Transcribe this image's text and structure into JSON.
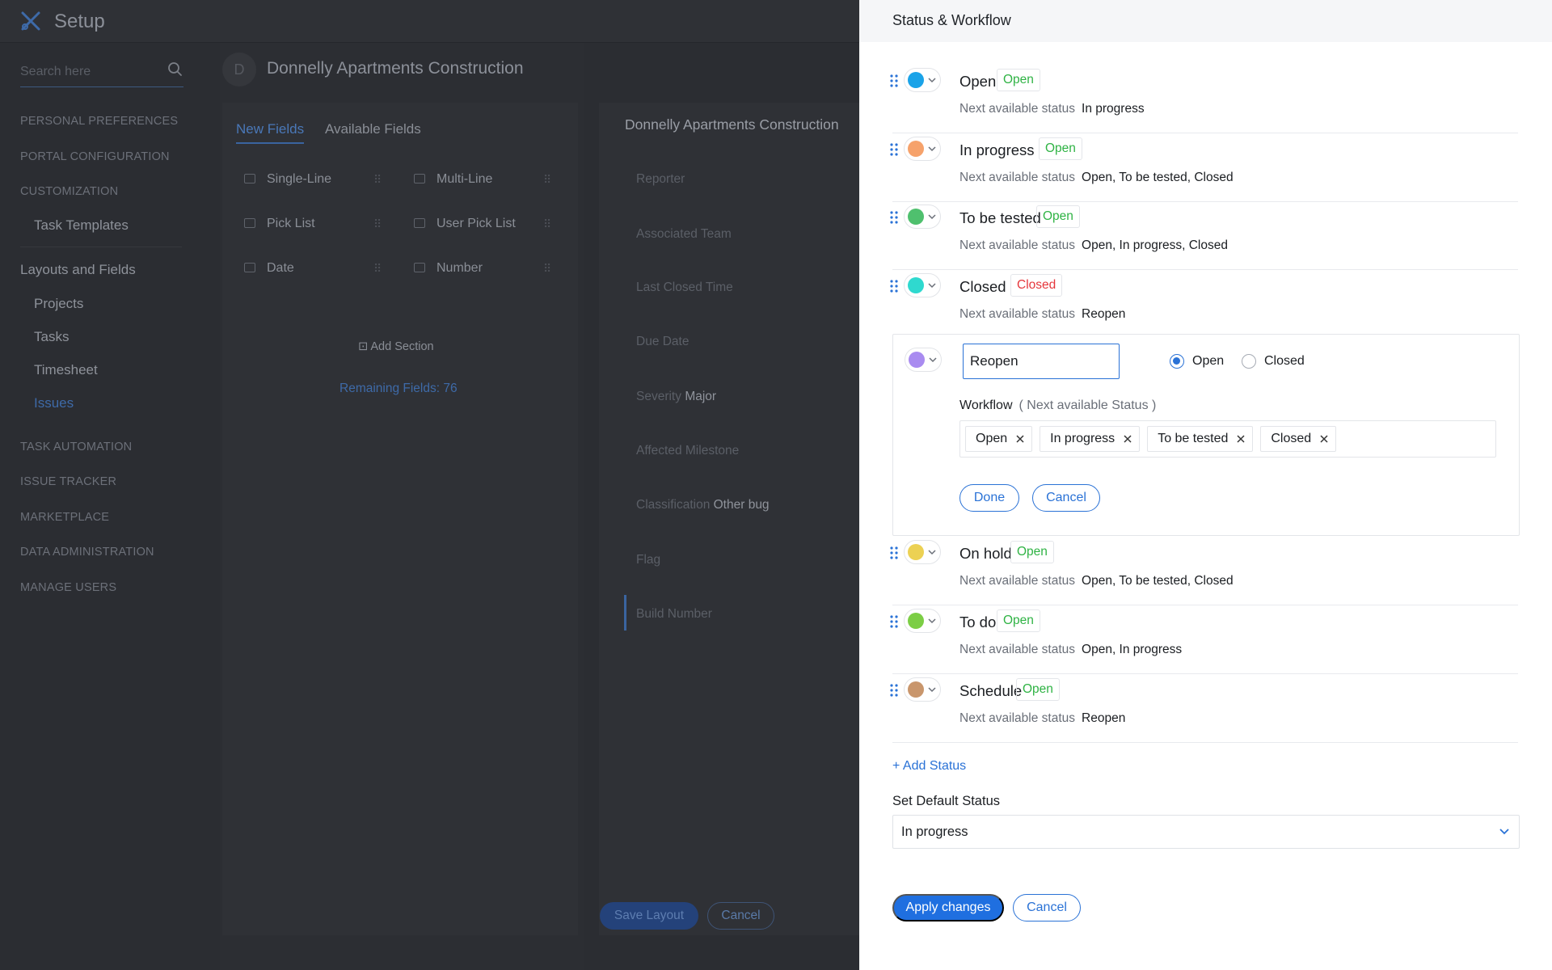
{
  "app": {
    "title": "Setup"
  },
  "search": {
    "placeholder": "Search here"
  },
  "sidebar": {
    "sections": [
      "PERSONAL PREFERENCES",
      "PORTAL CONFIGURATION",
      "CUSTOMIZATION",
      "TASK AUTOMATION",
      "ISSUE TRACKER",
      "MARKETPLACE",
      "DATA ADMINISTRATION",
      "MANAGE USERS"
    ],
    "task_templates": "Task Templates",
    "layouts_group": "Layouts and Fields",
    "layout_items": [
      "Projects",
      "Tasks",
      "Timesheet",
      "Issues"
    ]
  },
  "project": {
    "avatar": "D",
    "title": "Donnelly Apartments Construction"
  },
  "fields": {
    "tabs": [
      "New Fields",
      "Available Fields"
    ],
    "items": [
      "Single-Line",
      "Multi-Line",
      "Pick List",
      "User Pick List",
      "Date",
      "Number"
    ],
    "add_section": "Add Section",
    "remaining": "Remaining Fields: 76"
  },
  "preview": {
    "title": "Donnelly Apartments Construction",
    "rows": [
      {
        "label": "Reporter",
        "value": ""
      },
      {
        "label": "Associated Team",
        "value": ""
      },
      {
        "label": "Last Closed Time",
        "value": ""
      },
      {
        "label": "Due Date",
        "value": ""
      },
      {
        "label": "Severity",
        "value": "Major"
      },
      {
        "label": "Affected Milestone",
        "value": ""
      },
      {
        "label": "Classification",
        "value": "Other bug"
      },
      {
        "label": "Flag",
        "value": ""
      },
      {
        "label": "Build Number",
        "value": ""
      }
    ],
    "save_label": "Save Layout",
    "cancel_label": "Cancel"
  },
  "panel": {
    "title": "Status & Workflow",
    "next_label": "Next available status",
    "statuses": [
      {
        "name": "Open",
        "type": "Open",
        "color": "#1aa3e8",
        "next": "In progress"
      },
      {
        "name": "In progress",
        "type": "Open",
        "color": "#f6a26b",
        "next": "Open, To be tested, Closed"
      },
      {
        "name": "To be tested",
        "type": "Open",
        "color": "#4fc06e",
        "next": "Open, In progress, Closed"
      },
      {
        "name": "Closed",
        "type": "Closed",
        "color": "#2fd9cf",
        "next": "Reopen"
      },
      {
        "name": "On hold",
        "type": "Open",
        "color": "#ecd153",
        "next": "Open, To be tested, Closed"
      },
      {
        "name": "To do",
        "type": "Open",
        "color": "#7cce45",
        "next": "Open, In progress"
      },
      {
        "name": "Schedule",
        "type": "Open",
        "color": "#c9966c",
        "next": "Reopen"
      }
    ],
    "editor": {
      "color": "#a98bf0",
      "name_value": "Reopen",
      "radio_open": "Open",
      "radio_closed": "Closed",
      "workflow_label": "Workflow",
      "workflow_sub": "( Next available Status )",
      "chips": [
        "Open",
        "In progress",
        "To be tested",
        "Closed"
      ],
      "done_label": "Done",
      "cancel_label": "Cancel"
    },
    "add_status": "+ Add Status",
    "default_label": "Set Default Status",
    "default_value": "In progress",
    "apply_label": "Apply changes",
    "cancel_label": "Cancel",
    "colors": {
      "accent": "#2a72d6",
      "open_badge": "#2fb344",
      "closed_badge": "#e5363b"
    }
  }
}
